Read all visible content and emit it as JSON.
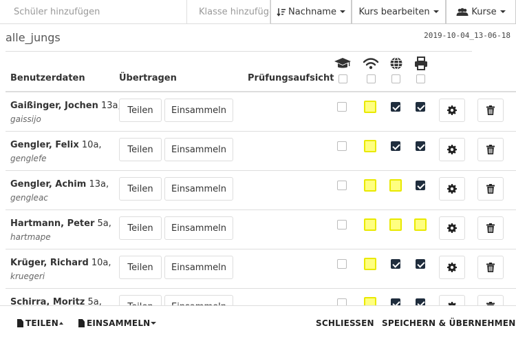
{
  "toolbar": {
    "search_placeholder": "Schüler hinzufügen",
    "class_placeholder": "Klasse hinzufügen",
    "sort_label": "Nachname",
    "edit_course_label": "Kurs bearbeiten",
    "courses_label": "Kurse"
  },
  "course": {
    "title": "alle_jungs",
    "timestamp": "2019-10-04_13-06-18"
  },
  "table": {
    "headers": {
      "user": "Benutzerdaten",
      "transfer": "Übertragen",
      "exam": "Prüfungsaufsicht"
    },
    "column_icons": [
      "graduation-cap-icon",
      "wifi-icon",
      "globe-icon",
      "printer-icon"
    ],
    "share_label": "Teilen",
    "collect_label": "Einsammeln",
    "rows": [
      {
        "name": "Gaißinger, Jochen",
        "class": "13a,",
        "login": "gaissijo",
        "exam": false,
        "wifi": "highlighted",
        "internet": true,
        "printing": true
      },
      {
        "name": "Gengler, Felix",
        "class": "10a,",
        "login": "genglefe",
        "exam": false,
        "wifi": "highlighted",
        "internet": true,
        "printing": true
      },
      {
        "name": "Gengler, Achim",
        "class": "13a,",
        "login": "gengleac",
        "exam": false,
        "wifi": "highlighted",
        "internet": "highlighted",
        "printing": true
      },
      {
        "name": "Hartmann, Peter",
        "class": "5a,",
        "login": "hartmape",
        "exam": false,
        "wifi": "highlighted",
        "internet": "highlighted",
        "printing": "highlighted"
      },
      {
        "name": "Krüger, Richard",
        "class": "10a,",
        "login": "kruegeri",
        "exam": false,
        "wifi": "highlighted",
        "internet": true,
        "printing": true
      },
      {
        "name": "Schirra, Moritz",
        "class": "5a,",
        "login": "",
        "exam": false,
        "wifi": "highlighted",
        "internet": true,
        "printing": true
      }
    ]
  },
  "footer": {
    "share_label": "TEILEN",
    "collect_label": "EINSAMMELN",
    "close_label": "SCHLIESSEN",
    "save_label": "SPEICHERN & ÜBERNEHMEN"
  },
  "colors": {
    "highlight": "#ffff80",
    "checked": "#1f2d3d"
  }
}
